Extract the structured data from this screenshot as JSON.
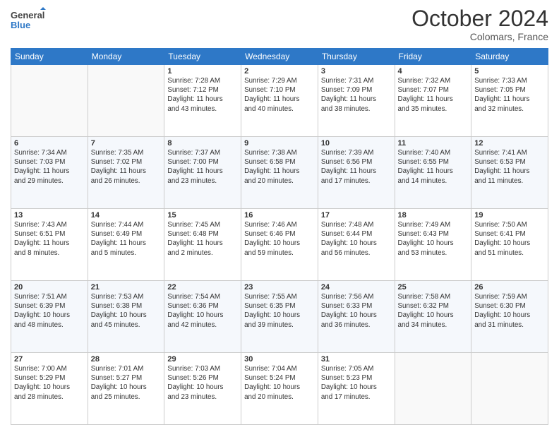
{
  "header": {
    "logo_line1": "General",
    "logo_line2": "Blue",
    "month": "October 2024",
    "location": "Colomars, France"
  },
  "days_of_week": [
    "Sunday",
    "Monday",
    "Tuesday",
    "Wednesday",
    "Thursday",
    "Friday",
    "Saturday"
  ],
  "weeks": [
    [
      {
        "day": "",
        "info": ""
      },
      {
        "day": "",
        "info": ""
      },
      {
        "day": "1",
        "info": "Sunrise: 7:28 AM\nSunset: 7:12 PM\nDaylight: 11 hours\nand 43 minutes."
      },
      {
        "day": "2",
        "info": "Sunrise: 7:29 AM\nSunset: 7:10 PM\nDaylight: 11 hours\nand 40 minutes."
      },
      {
        "day": "3",
        "info": "Sunrise: 7:31 AM\nSunset: 7:09 PM\nDaylight: 11 hours\nand 38 minutes."
      },
      {
        "day": "4",
        "info": "Sunrise: 7:32 AM\nSunset: 7:07 PM\nDaylight: 11 hours\nand 35 minutes."
      },
      {
        "day": "5",
        "info": "Sunrise: 7:33 AM\nSunset: 7:05 PM\nDaylight: 11 hours\nand 32 minutes."
      }
    ],
    [
      {
        "day": "6",
        "info": "Sunrise: 7:34 AM\nSunset: 7:03 PM\nDaylight: 11 hours\nand 29 minutes."
      },
      {
        "day": "7",
        "info": "Sunrise: 7:35 AM\nSunset: 7:02 PM\nDaylight: 11 hours\nand 26 minutes."
      },
      {
        "day": "8",
        "info": "Sunrise: 7:37 AM\nSunset: 7:00 PM\nDaylight: 11 hours\nand 23 minutes."
      },
      {
        "day": "9",
        "info": "Sunrise: 7:38 AM\nSunset: 6:58 PM\nDaylight: 11 hours\nand 20 minutes."
      },
      {
        "day": "10",
        "info": "Sunrise: 7:39 AM\nSunset: 6:56 PM\nDaylight: 11 hours\nand 17 minutes."
      },
      {
        "day": "11",
        "info": "Sunrise: 7:40 AM\nSunset: 6:55 PM\nDaylight: 11 hours\nand 14 minutes."
      },
      {
        "day": "12",
        "info": "Sunrise: 7:41 AM\nSunset: 6:53 PM\nDaylight: 11 hours\nand 11 minutes."
      }
    ],
    [
      {
        "day": "13",
        "info": "Sunrise: 7:43 AM\nSunset: 6:51 PM\nDaylight: 11 hours\nand 8 minutes."
      },
      {
        "day": "14",
        "info": "Sunrise: 7:44 AM\nSunset: 6:49 PM\nDaylight: 11 hours\nand 5 minutes."
      },
      {
        "day": "15",
        "info": "Sunrise: 7:45 AM\nSunset: 6:48 PM\nDaylight: 11 hours\nand 2 minutes."
      },
      {
        "day": "16",
        "info": "Sunrise: 7:46 AM\nSunset: 6:46 PM\nDaylight: 10 hours\nand 59 minutes."
      },
      {
        "day": "17",
        "info": "Sunrise: 7:48 AM\nSunset: 6:44 PM\nDaylight: 10 hours\nand 56 minutes."
      },
      {
        "day": "18",
        "info": "Sunrise: 7:49 AM\nSunset: 6:43 PM\nDaylight: 10 hours\nand 53 minutes."
      },
      {
        "day": "19",
        "info": "Sunrise: 7:50 AM\nSunset: 6:41 PM\nDaylight: 10 hours\nand 51 minutes."
      }
    ],
    [
      {
        "day": "20",
        "info": "Sunrise: 7:51 AM\nSunset: 6:39 PM\nDaylight: 10 hours\nand 48 minutes."
      },
      {
        "day": "21",
        "info": "Sunrise: 7:53 AM\nSunset: 6:38 PM\nDaylight: 10 hours\nand 45 minutes."
      },
      {
        "day": "22",
        "info": "Sunrise: 7:54 AM\nSunset: 6:36 PM\nDaylight: 10 hours\nand 42 minutes."
      },
      {
        "day": "23",
        "info": "Sunrise: 7:55 AM\nSunset: 6:35 PM\nDaylight: 10 hours\nand 39 minutes."
      },
      {
        "day": "24",
        "info": "Sunrise: 7:56 AM\nSunset: 6:33 PM\nDaylight: 10 hours\nand 36 minutes."
      },
      {
        "day": "25",
        "info": "Sunrise: 7:58 AM\nSunset: 6:32 PM\nDaylight: 10 hours\nand 34 minutes."
      },
      {
        "day": "26",
        "info": "Sunrise: 7:59 AM\nSunset: 6:30 PM\nDaylight: 10 hours\nand 31 minutes."
      }
    ],
    [
      {
        "day": "27",
        "info": "Sunrise: 7:00 AM\nSunset: 5:29 PM\nDaylight: 10 hours\nand 28 minutes."
      },
      {
        "day": "28",
        "info": "Sunrise: 7:01 AM\nSunset: 5:27 PM\nDaylight: 10 hours\nand 25 minutes."
      },
      {
        "day": "29",
        "info": "Sunrise: 7:03 AM\nSunset: 5:26 PM\nDaylight: 10 hours\nand 23 minutes."
      },
      {
        "day": "30",
        "info": "Sunrise: 7:04 AM\nSunset: 5:24 PM\nDaylight: 10 hours\nand 20 minutes."
      },
      {
        "day": "31",
        "info": "Sunrise: 7:05 AM\nSunset: 5:23 PM\nDaylight: 10 hours\nand 17 minutes."
      },
      {
        "day": "",
        "info": ""
      },
      {
        "day": "",
        "info": ""
      }
    ]
  ]
}
